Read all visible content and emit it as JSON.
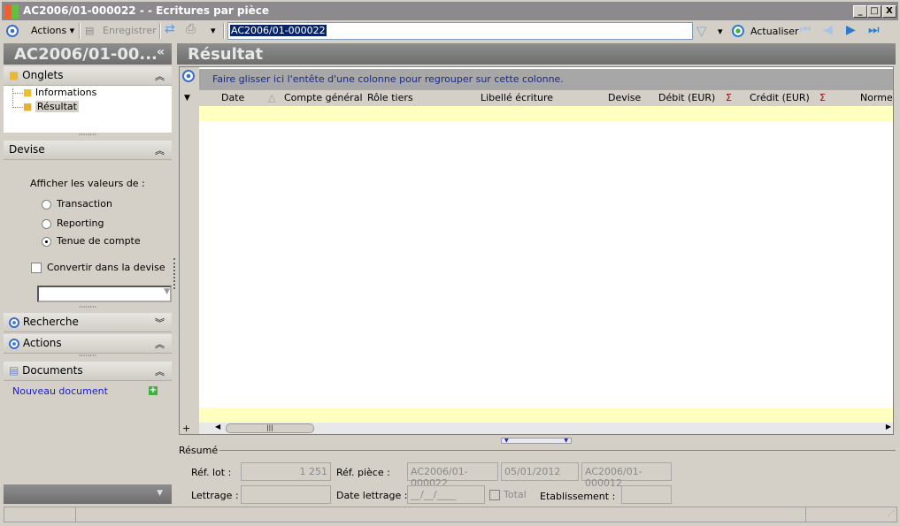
{
  "window": {
    "title": "AC2006/01-000022 -  - Ecritures par pièce",
    "min": "_",
    "max": "□",
    "close": "X"
  },
  "toolbar": {
    "actions": "Actions",
    "save": "Enregistrer",
    "search_value": "AC2006/01-000022",
    "refresh": "Actualiser"
  },
  "left": {
    "title": "AC2006/01-00...",
    "collapse": "«",
    "onglets": {
      "label": "Onglets",
      "items": [
        "Informations",
        "Résultat"
      ]
    },
    "devise": {
      "label": "Devise",
      "prompt": "Afficher les valeurs de :",
      "options": [
        "Transaction",
        "Reporting",
        "Tenue de compte"
      ],
      "selected": 2,
      "convert": "Convertir dans la devise",
      "convert_checked": false
    },
    "recherche": "Recherche",
    "actions": "Actions",
    "documents": "Documents",
    "new_doc": "Nouveau document"
  },
  "main": {
    "title": "Résultat",
    "group_hint": "Faire glisser ici l'entête d'une colonne pour regrouper sur cette colonne.",
    "columns": [
      "Date",
      "Compte général",
      "Rôle tiers",
      "Libellé écriture",
      "Devise",
      "Débit (EUR)",
      "Crédit (EUR)",
      "Norme"
    ],
    "sigma": "Σ"
  },
  "resume": {
    "label": "Résumé",
    "ref_lot_label": "Réf. lot :",
    "ref_lot": "1 251",
    "ref_piece_label": "Réf. pièce :",
    "ref_piece": "AC2006/01-000022",
    "date": "05/01/2012",
    "ref_piece2": "AC2006/01-000012",
    "lettrage_label": "Lettrage :",
    "lettrage": "",
    "date_lettrage_label": "Date lettrage :",
    "date_lettrage": "__/__/____",
    "total": "Total",
    "etab_label": "Etablissement :",
    "etab": ""
  }
}
